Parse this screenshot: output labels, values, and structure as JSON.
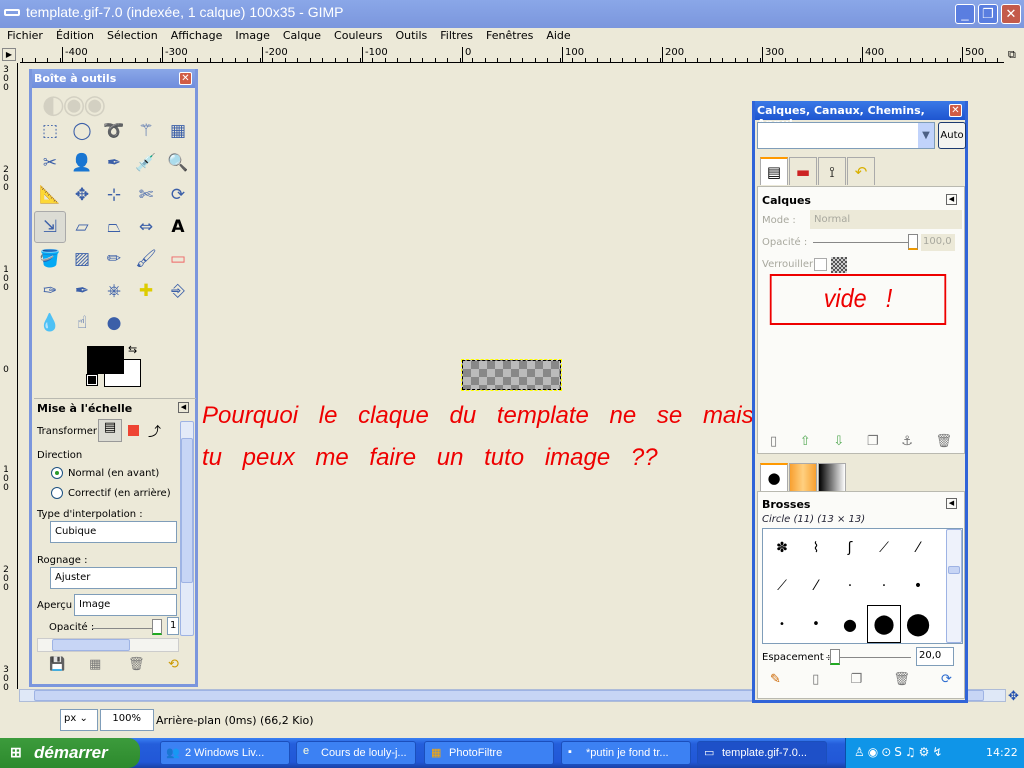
{
  "window": {
    "title": "template.gif-7.0 (indexée, 1 calque) 100x35 - GIMP",
    "minimize": "_",
    "restore": "❐",
    "close": "✕"
  },
  "menu": [
    "Fichier",
    "Édition",
    "Sélection",
    "Affichage",
    "Image",
    "Calque",
    "Couleurs",
    "Outils",
    "Filtres",
    "Fenêtres",
    "Aide"
  ],
  "rulers": {
    "horizontal": [
      "-400",
      "-300",
      "-200",
      "-100",
      "0",
      "100",
      "200",
      "300",
      "400",
      "500"
    ],
    "vertical": [
      "300",
      "200",
      "100",
      "0",
      "100",
      "200",
      "300"
    ]
  },
  "annotations": {
    "line1": "Pourquoi le claque du template ne se mais pas ??",
    "line2": "tu peux me faire un tuto image ??",
    "empty_label": "vide !"
  },
  "status": {
    "unit": "px",
    "zoom": "100%",
    "info": "Arrière-plan (0ms) (66,2 Kio)"
  },
  "toolbox": {
    "title": "Boîte à outils",
    "tools": [
      "rect-select",
      "ellipse-select",
      "free-select",
      "fuzzy-select",
      "select-by-color",
      "scissors",
      "foreground-select",
      "paths",
      "color-picker",
      "zoom",
      "measure",
      "move",
      "align",
      "crop",
      "rotate",
      "scale",
      "shear",
      "perspective",
      "flip",
      "text",
      "bucket-fill",
      "blend",
      "pencil",
      "paintbrush",
      "eraser",
      "airbrush",
      "ink",
      "clone",
      "heal",
      "perspective-clone",
      "blur",
      "smudge",
      "dodge-burn"
    ],
    "colors": {
      "foreground": "#000000",
      "background": "#ffffff"
    },
    "options": {
      "title": "Mise à l'échelle",
      "transform_label": "Transformer :",
      "direction_label": "Direction",
      "direction_options": [
        "Normal (en avant)",
        "Correctif (en arrière)"
      ],
      "direction_selected": "Normal (en avant)",
      "interpolation_label": "Type d'interpolation :",
      "interpolation_value": "Cubique",
      "clipping_label": "Rognage :",
      "clipping_value": "Ajuster",
      "preview_label": "Aperçu :",
      "preview_value": "Image",
      "opacity_label": "Opacité :",
      "opacity_value": "1"
    }
  },
  "dock": {
    "title": "Calques, Canaux, Chemins, Annul...",
    "auto_label": "Auto",
    "layers": {
      "title": "Calques",
      "mode_label": "Mode :",
      "mode_value": "Normal",
      "opacity_label": "Opacité :",
      "opacity_value": "100,0",
      "lock_label": "Verrouiller :"
    },
    "brushes": {
      "title": "Brosses",
      "selected": "Circle (11) (13 × 13)",
      "spacing_label": "Espacement :",
      "spacing_value": "20,0"
    }
  },
  "taskbar": {
    "start": "démarrer",
    "tasks": [
      "2 Windows Liv...",
      "Cours de louly-j...",
      "PhotoFiltre",
      "*putin je fond tr...",
      "template.gif-7.0..."
    ],
    "clock": "14:22"
  },
  "colors": {
    "annotation": "#ee0000",
    "titlebar": "#7b96dd",
    "dock_border": "#3064d8"
  }
}
